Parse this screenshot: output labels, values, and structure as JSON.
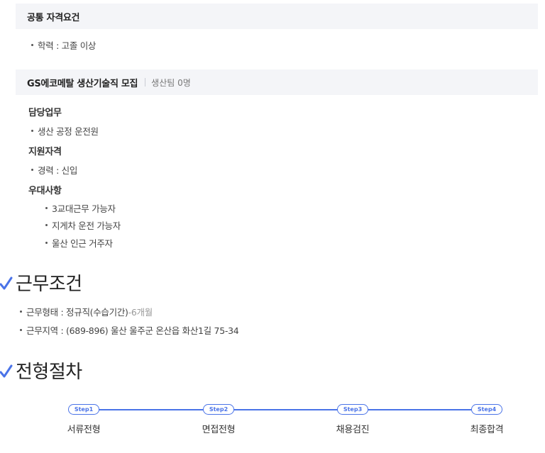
{
  "common": {
    "title": "공통 자격요건",
    "items": [
      "학력 : 고졸 이상"
    ]
  },
  "job": {
    "title": "GS에코메탈 생산기술직 모집",
    "sub": "생산팀 0명",
    "duties_label": "담당업무",
    "duties": [
      "생산 공정 운전원"
    ],
    "qual_label": "지원자격",
    "quals": [
      "경력 : 신입"
    ],
    "pref_label": "우대사항",
    "prefs": [
      "3교대근무 가능자",
      "지게차 운전 가능자",
      "울산 인근 거주자"
    ]
  },
  "conditions": {
    "title": "근무조건",
    "type_label": "근무형태 : 정규직(수습기간)",
    "type_extra": "-6개월",
    "location": "근무지역 : (689-896) 울산 울주군 온산읍 화산1길 75-34"
  },
  "process": {
    "title": "전형절차",
    "steps": [
      {
        "badge": "Step1",
        "label": "서류전형"
      },
      {
        "badge": "Step2",
        "label": "면접전형"
      },
      {
        "badge": "Step3",
        "label": "채용검진"
      },
      {
        "badge": "Step4",
        "label": "최종합격"
      }
    ]
  },
  "colors": {
    "accent": "#4a73e8",
    "header_bg": "#f4f5f8"
  },
  "icons": {
    "heading_mark": "check-icon"
  }
}
